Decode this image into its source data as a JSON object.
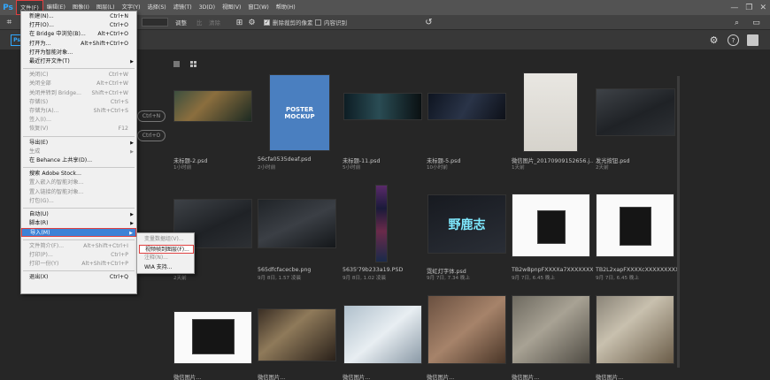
{
  "menubar": {
    "logo": "Ps",
    "items": [
      "文件(F)",
      "编辑(E)",
      "图像(I)",
      "图层(L)",
      "文字(Y)",
      "选择(S)",
      "滤镜(T)",
      "3D(D)",
      "视图(V)",
      "窗口(W)",
      "帮助(H)"
    ]
  },
  "window_controls": {
    "minimize": "—",
    "restore": "❐",
    "close": "✕"
  },
  "options_bar": {
    "label_a": "调整",
    "label_b": "比",
    "clear": "清除",
    "clear2": "拉直",
    "delete_cropped": "删除裁剪的像素",
    "content_aware": "内容识别"
  },
  "start": {
    "logo_text": "Ps",
    "open_btn": "Ctrl+N",
    "new_btn": "Ctrl+O"
  },
  "file_menu": [
    {
      "label": "新建(N)...",
      "sc": "Ctrl+N",
      "dis": false,
      "sub": false
    },
    {
      "label": "打开(O)...",
      "sc": "Ctrl+O",
      "dis": false,
      "sub": false
    },
    {
      "label": "在 Bridge 中浏览(B)...",
      "sc": "Alt+Ctrl+O",
      "dis": false,
      "sub": false
    },
    {
      "label": "打开为...",
      "sc": "Alt+Shift+Ctrl+O",
      "dis": false,
      "sub": false
    },
    {
      "label": "打开为智能对象...",
      "sc": "",
      "dis": false,
      "sub": false
    },
    {
      "label": "最近打开文件(T)",
      "sc": "",
      "dis": false,
      "sub": true
    },
    {
      "label": "关闭(C)",
      "sc": "Ctrl+W",
      "dis": true,
      "sub": false
    },
    {
      "label": "关闭全部",
      "sc": "Alt+Ctrl+W",
      "dis": true,
      "sub": false
    },
    {
      "label": "关闭并转到 Bridge...",
      "sc": "Shift+Ctrl+W",
      "dis": true,
      "sub": false
    },
    {
      "label": "存储(S)",
      "sc": "Ctrl+S",
      "dis": true,
      "sub": false
    },
    {
      "label": "存储为(A)...",
      "sc": "Shift+Ctrl+S",
      "dis": true,
      "sub": false
    },
    {
      "label": "签入(I)...",
      "sc": "",
      "dis": true,
      "sub": false
    },
    {
      "label": "恢复(V)",
      "sc": "F12",
      "dis": true,
      "sub": false
    },
    {
      "label": "导出(E)",
      "sc": "",
      "dis": false,
      "sub": true
    },
    {
      "label": "生成",
      "sc": "",
      "dis": true,
      "sub": true
    },
    {
      "label": "在 Behance 上共享(D)...",
      "sc": "",
      "dis": false,
      "sub": false
    },
    {
      "label": "搜索 Adobe Stock...",
      "sc": "",
      "dis": false,
      "sub": false
    },
    {
      "label": "置入嵌入的智能对象...",
      "sc": "",
      "dis": true,
      "sub": false
    },
    {
      "label": "置入链接的智能对象...",
      "sc": "",
      "dis": true,
      "sub": false
    },
    {
      "label": "打包(G)...",
      "sc": "",
      "dis": true,
      "sub": false
    },
    {
      "label": "自动(U)",
      "sc": "",
      "dis": false,
      "sub": true
    },
    {
      "label": "脚本(R)",
      "sc": "",
      "dis": false,
      "sub": true
    },
    {
      "label": "导入(M)",
      "sc": "",
      "dis": false,
      "sub": true
    },
    {
      "label": "文件简介(F)...",
      "sc": "Alt+Shift+Ctrl+I",
      "dis": true,
      "sub": false
    },
    {
      "label": "打印(P)...",
      "sc": "Ctrl+P",
      "dis": true,
      "sub": false
    },
    {
      "label": "打印一份(Y)",
      "sc": "Alt+Shift+Ctrl+P",
      "dis": true,
      "sub": false
    },
    {
      "label": "退出(X)",
      "sc": "Ctrl+Q",
      "dis": false,
      "sub": false
    }
  ],
  "import_submenu": [
    {
      "label": "变量数据组(V)...",
      "dis": true
    },
    {
      "label": "视频帧到图层(F)...",
      "dis": false
    },
    {
      "label": "注释(N)...",
      "dis": true
    },
    {
      "label": "WIA 支持...",
      "dis": false
    }
  ],
  "thumbnails": [
    {
      "caption": "未标题-2.psd",
      "sub": "1小时前"
    },
    {
      "caption": "56cfa0535deaf.psd",
      "sub": "2小时前",
      "poster": "POSTER MOCKUP"
    },
    {
      "caption": "未标题-11.psd",
      "sub": "5小时前"
    },
    {
      "caption": "未标题-5.psd",
      "sub": "10小时前"
    },
    {
      "caption": "微信图片_2017090915265​6.j...",
      "sub": "1天前"
    },
    {
      "caption": "发光按钮.psd",
      "sub": "2天前"
    },
    {
      "caption": "",
      "sub": "2天前"
    },
    {
      "caption": "565dfcfacecbe.png",
      "sub": "9月 8日, 1.57 凌晨"
    },
    {
      "caption": "5635'79b233a19.PSD",
      "sub": "9月 8日, 1.02 凌晨"
    },
    {
      "caption": "霓虹灯字体.psd",
      "sub": "9月 7日, 7.34 晚上",
      "neon": "野鹿志"
    },
    {
      "caption": "TB2wBpnpFXXXXa7XXXXXXX...",
      "sub": "9月 7日, 6.45 晚上"
    },
    {
      "caption": "TB2L2xapFXXXXcXXXXXXXXX...",
      "sub": "9月 7日, 6.45 晚上"
    },
    {
      "caption": "微信图片...",
      "sub": ""
    },
    {
      "caption": "微信图片...",
      "sub": ""
    },
    {
      "caption": "微信图片...",
      "sub": ""
    },
    {
      "caption": "微信图片...",
      "sub": ""
    },
    {
      "caption": "微信图片...",
      "sub": ""
    },
    {
      "caption": "微信图片...",
      "sub": ""
    }
  ]
}
